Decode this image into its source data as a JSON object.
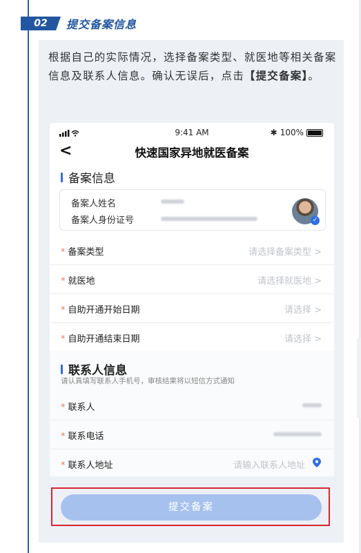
{
  "step": {
    "number": "02",
    "title": "提交备案信息"
  },
  "intro": {
    "text": "根据自己的实际情况，选择备案类型、就医地等相关备案信息及联系人信息。确认无误后，点击",
    "emphasis": "【提交备案】",
    "end": "。"
  },
  "phone": {
    "status": {
      "time": "9:41 AM",
      "battery": "100%",
      "bluetooth": "✱"
    },
    "nav": {
      "back": "<",
      "title": "快速国家异地就医备案"
    },
    "section1": {
      "title": "备案信息",
      "person": {
        "name_label": "备案人姓名",
        "id_label": "备案人身份证号"
      },
      "rows": [
        {
          "label": "备案类型",
          "placeholder": "请选择备案类型 >"
        },
        {
          "label": "就医地",
          "placeholder": "请选择就医地 >"
        },
        {
          "label": "自助开通开始日期",
          "placeholder": "请选择 >"
        },
        {
          "label": "自助开通结束日期",
          "placeholder": "请选择 >"
        }
      ]
    },
    "section2": {
      "title": "联系人信息",
      "hint": "请认真填写联系人手机号，审核结果将以短信方式通知",
      "rows": [
        {
          "label": "联系人",
          "placeholder": ""
        },
        {
          "label": "联系电话",
          "placeholder": ""
        },
        {
          "label": "联系人地址",
          "placeholder": "请输入联系人地址"
        }
      ]
    },
    "required_mark": "*"
  },
  "submit": {
    "label": "提交备案"
  },
  "colors": {
    "accent": "#2356a0",
    "button": "#a6c1ee",
    "highlight": "#d9232f",
    "required": "#f07a5a"
  }
}
